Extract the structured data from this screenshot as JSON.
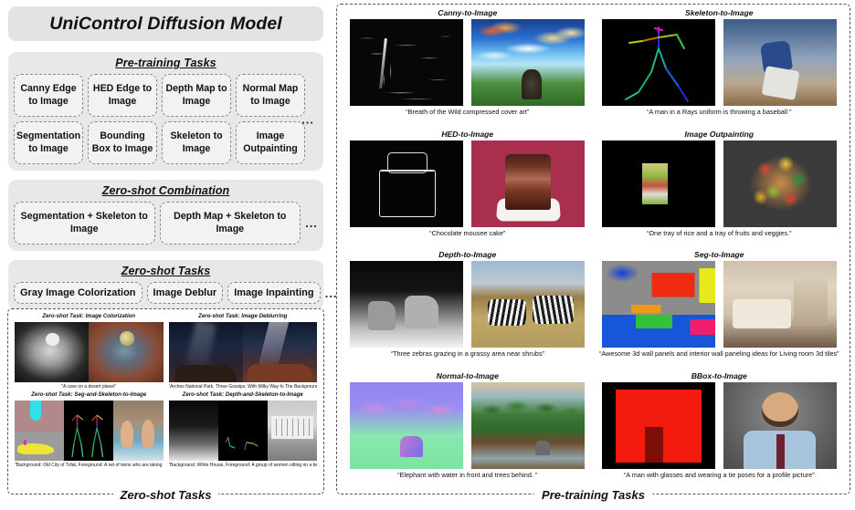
{
  "title": "UniControl Diffusion Model",
  "left": {
    "pretraining": {
      "heading": "Pre-training Tasks",
      "tasks": [
        "Canny Edge to Image",
        "HED Edge to Image",
        "Depth Map to Image",
        "Normal Map to Image",
        "Segmentation to Image",
        "Bounding Box to Image",
        "Skeleton to Image",
        "Image Outpainting"
      ],
      "ellipsis": "..."
    },
    "zeroshot_combination": {
      "heading": "Zero-shot Combination",
      "tasks": [
        "Segmentation + Skeleton to Image",
        "Depth Map + Skeleton to Image"
      ],
      "ellipsis": "..."
    },
    "zeroshot_tasks": {
      "heading": "Zero-shot Tasks",
      "tasks": [
        "Gray Image Colorization",
        "Image Deblur",
        "Image Inpainting"
      ],
      "ellipsis": "..."
    },
    "examples_frame_label": "Zero-shot Tasks",
    "examples": [
      {
        "prefix": "Zero-shot Task:",
        "task": "Image Colorization",
        "caption": "“A cave on a desert planet”"
      },
      {
        "prefix": "Zero-shot Task:",
        "task": "Image Deblurring",
        "caption": "“Arches National Park, Three Gossips, With Milky Way In The Background”"
      },
      {
        "prefix": "Zero-shot Task:",
        "task": "Seg-and-Skeleton-to-Image",
        "caption": "“Background: Old City of Tzfat, Foreground: A set of twins who are taking a bath”"
      },
      {
        "prefix": "Zero-shot Task:",
        "task": "Depth-and-Skeleton-to-Image",
        "caption": "“Background: White House, Foreground: A group of women sitting on a bench”"
      }
    ]
  },
  "right": {
    "frame_label": "Pre-training Tasks",
    "examples": [
      {
        "task": "Canny-to-Image",
        "caption": "“Breath of the Wild compressed cover art”"
      },
      {
        "task": "Skeleton-to-Image",
        "caption": "“A man in a Rays uniform is throwing a baseball ”"
      },
      {
        "task": "HED-to-Image",
        "caption": "“Chocolate mousee cake”"
      },
      {
        "task": "Image Outpainting",
        "caption": "“One tray of rice and a tray of fruits and veggies.”"
      },
      {
        "task": "Depth-to-Image",
        "caption": "“Three zebras grazing in a grassy area near shrubs”"
      },
      {
        "task": "Seg-to-Image",
        "caption": "“Awesome 3d wall panels and interior wall paneling ideas for Living room 3d tiles”"
      },
      {
        "task": "Normal-to-Image",
        "caption": "“Elephant with water in front and trees behind. ”"
      },
      {
        "task": "BBox-to-Image",
        "caption": "“A man with glasses and wearing a tie poses for a profile picture”"
      }
    ]
  },
  "colors": {
    "panel_bg": "#e8e8e8",
    "title_bg": "#e3e3e3",
    "chip_bg": "#f2f2f2",
    "chip_border": "#8a8a8a",
    "text": "#111111"
  }
}
